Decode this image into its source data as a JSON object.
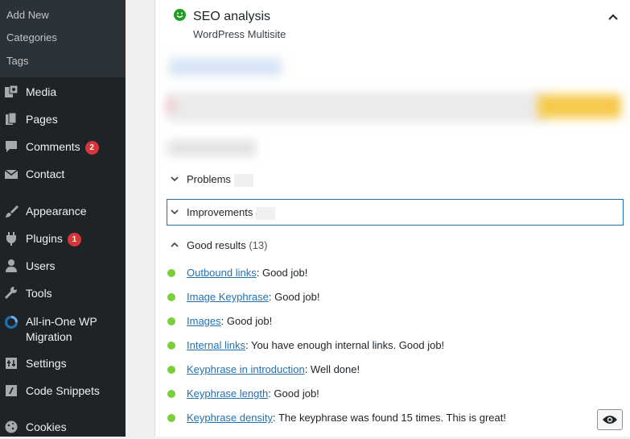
{
  "sidebar": {
    "submenu": [
      "Add New",
      "Categories",
      "Tags"
    ],
    "items": [
      {
        "label": "Media",
        "icon": "media-icon"
      },
      {
        "label": "Pages",
        "icon": "pages-icon"
      },
      {
        "label": "Comments",
        "icon": "comments-icon",
        "badge": "2"
      },
      {
        "label": "Contact",
        "icon": "contact-icon"
      },
      {
        "label": "Appearance",
        "icon": "appearance-icon"
      },
      {
        "label": "Plugins",
        "icon": "plugins-icon",
        "badge": "1"
      },
      {
        "label": "Users",
        "icon": "users-icon"
      },
      {
        "label": "Tools",
        "icon": "tools-icon"
      },
      {
        "label": "All-in-One WP",
        "label2": "Migration",
        "icon": "migration-icon"
      },
      {
        "label": "Settings",
        "icon": "settings-icon"
      },
      {
        "label": "Code Snippets",
        "icon": "code-snippets-icon"
      },
      {
        "label": "Cookies",
        "icon": "cookies-icon"
      }
    ]
  },
  "seo": {
    "title": "SEO analysis",
    "subtitle": "WordPress Multisite",
    "status_color": "#1e9e1e",
    "sections": {
      "problems": "Problems",
      "improvements": "Improvements",
      "good_results": "Good results",
      "good_count": "(13)"
    },
    "results": [
      {
        "link": "Outbound links",
        "text": ": Good job!"
      },
      {
        "link": "Image Keyphrase",
        "text": ": Good job!"
      },
      {
        "link": "Images",
        "text": ": Good job!"
      },
      {
        "link": "Internal links",
        "text": ": You have enough internal links. Good job!"
      },
      {
        "link": "Keyphrase in introduction",
        "text": ": Well done!"
      },
      {
        "link": "Keyphrase length",
        "text": ": Good job!"
      },
      {
        "link": "Keyphrase density",
        "text": ": The keyphrase was found 15 times. This is great!"
      }
    ]
  }
}
